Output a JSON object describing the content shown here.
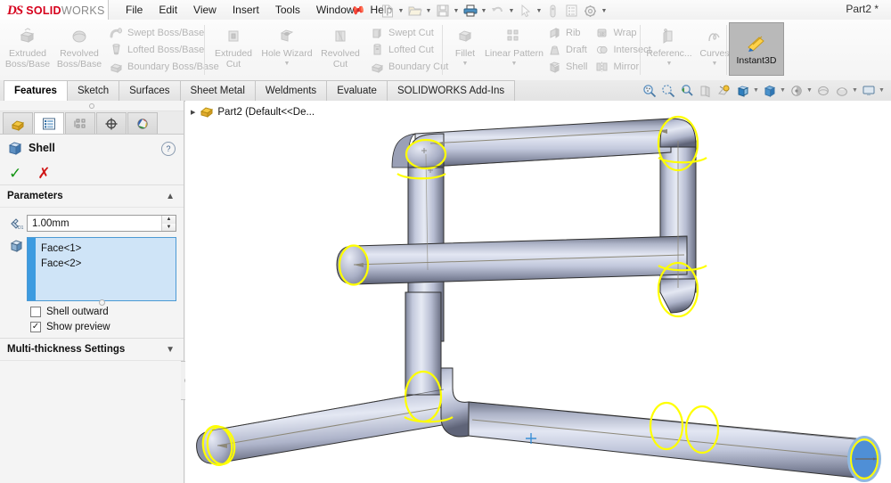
{
  "app": {
    "brand_ds": "DS",
    "brand_solid": "SOLID",
    "brand_works": "WORKS",
    "document_title": "Part2 *"
  },
  "menubar": {
    "items": [
      {
        "label": "File"
      },
      {
        "label": "Edit"
      },
      {
        "label": "View"
      },
      {
        "label": "Insert"
      },
      {
        "label": "Tools"
      },
      {
        "label": "Window"
      },
      {
        "label": "Help"
      }
    ],
    "pin_icon": "pushpin-icon"
  },
  "quick_access": {
    "buttons": [
      {
        "name": "new-document-icon",
        "has_dropdown": true
      },
      {
        "name": "open-document-icon",
        "has_dropdown": true
      },
      {
        "name": "save-icon",
        "has_dropdown": true
      },
      {
        "name": "print-icon",
        "has_dropdown": true,
        "active": true
      },
      {
        "name": "undo-icon",
        "has_dropdown": true
      },
      {
        "name": "select-cursor-icon",
        "has_dropdown": true
      },
      {
        "name": "rebuild-icon",
        "has_dropdown": false
      },
      {
        "name": "file-properties-icon",
        "has_dropdown": false
      },
      {
        "name": "options-gear-icon",
        "has_dropdown": true
      }
    ]
  },
  "ribbon": {
    "groups": [
      {
        "big": [
          {
            "label": "Extruded\nBoss/Base",
            "icon": "extruded-boss-icon",
            "enabled": false,
            "dropdown": false
          },
          {
            "label": "Revolved\nBoss/Base",
            "icon": "revolved-boss-icon",
            "enabled": false,
            "dropdown": false
          }
        ],
        "small": [
          {
            "label": "Swept Boss/Base",
            "icon": "swept-boss-icon"
          },
          {
            "label": "Lofted Boss/Base",
            "icon": "lofted-boss-icon"
          },
          {
            "label": "Boundary Boss/Base",
            "icon": "boundary-boss-icon"
          }
        ]
      },
      {
        "big": [
          {
            "label": "Extruded\nCut",
            "icon": "extruded-cut-icon",
            "enabled": false,
            "dropdown": false
          },
          {
            "label": "Hole Wizard",
            "icon": "hole-wizard-icon",
            "enabled": false,
            "dropdown": true
          },
          {
            "label": "Revolved\nCut",
            "icon": "revolved-cut-icon",
            "enabled": false,
            "dropdown": false
          }
        ],
        "small": [
          {
            "label": "Swept Cut",
            "icon": "swept-cut-icon"
          },
          {
            "label": "Lofted Cut",
            "icon": "lofted-cut-icon"
          },
          {
            "label": "Boundary Cut",
            "icon": "boundary-cut-icon"
          }
        ]
      },
      {
        "big": [
          {
            "label": "Fillet",
            "icon": "fillet-icon",
            "enabled": false,
            "dropdown": true
          },
          {
            "label": "Linear Pattern",
            "icon": "linear-pattern-icon",
            "enabled": false,
            "dropdown": true
          }
        ],
        "small": [
          {
            "label": "Rib",
            "icon": "rib-icon"
          },
          {
            "label": "Draft",
            "icon": "draft-icon"
          },
          {
            "label": "Shell",
            "icon": "shell-icon"
          }
        ],
        "small2": [
          {
            "label": "Wrap",
            "icon": "wrap-icon"
          },
          {
            "label": "Intersect",
            "icon": "intersect-icon"
          },
          {
            "label": "Mirror",
            "icon": "mirror-icon"
          }
        ]
      },
      {
        "big": [
          {
            "label": "Referenc...",
            "icon": "reference-geometry-icon",
            "enabled": false,
            "dropdown": true
          },
          {
            "label": "Curves",
            "icon": "curves-icon",
            "enabled": false,
            "dropdown": true
          }
        ]
      }
    ],
    "instant3d": {
      "label": "Instant3D",
      "icon": "instant3d-icon",
      "active": true
    }
  },
  "command_tabs": {
    "items": [
      {
        "label": "Features",
        "active": true
      },
      {
        "label": "Sketch",
        "active": false
      },
      {
        "label": "Surfaces",
        "active": false
      },
      {
        "label": "Sheet Metal",
        "active": false
      },
      {
        "label": "Weldments",
        "active": false
      },
      {
        "label": "Evaluate",
        "active": false
      },
      {
        "label": "SOLIDWORKS Add-Ins",
        "active": false
      }
    ]
  },
  "view_toolbar": {
    "buttons": [
      {
        "name": "zoom-to-fit-icon",
        "dropdown": false
      },
      {
        "name": "zoom-to-area-icon",
        "dropdown": false
      },
      {
        "name": "previous-view-icon",
        "dropdown": false
      },
      {
        "name": "section-view-icon",
        "dropdown": false
      },
      {
        "name": "view-orientation-icon",
        "dropdown": false
      },
      {
        "name": "display-style-icon",
        "dropdown": true
      },
      {
        "name": "hide-show-items-icon",
        "dropdown": true
      },
      {
        "name": "edit-appearance-icon",
        "dropdown": true
      },
      {
        "name": "apply-scene-icon",
        "dropdown": false
      },
      {
        "name": "view-settings-icon",
        "dropdown": true
      },
      {
        "name": "viewport-icon",
        "dropdown": true
      }
    ]
  },
  "property_manager": {
    "tabs": [
      {
        "name": "feature-manager-tab",
        "icon": "feature-tree-icon",
        "active": false
      },
      {
        "name": "property-manager-tab",
        "icon": "property-manager-icon",
        "active": true
      },
      {
        "name": "configuration-manager-tab",
        "icon": "configuration-icon",
        "active": false
      },
      {
        "name": "dimxpert-manager-tab",
        "icon": "dimxpert-icon",
        "active": false
      },
      {
        "name": "display-manager-tab",
        "icon": "display-manager-icon",
        "active": false
      }
    ],
    "title": "Shell",
    "title_icon": "shell-feature-icon",
    "help_icon": "help-question-icon",
    "accept_icon": "green-check-icon",
    "cancel_icon": "red-x-icon",
    "sections": [
      {
        "title": "Parameters",
        "thickness": {
          "icon": "thickness-icon",
          "value": "1.00mm"
        },
        "faces_to_remove": {
          "icon": "face-selection-icon",
          "items": [
            "Face<1>",
            "Face<2>"
          ]
        },
        "checkboxes": [
          {
            "label": "Shell outward",
            "checked": false
          },
          {
            "label": "Show preview",
            "checked": true
          }
        ]
      },
      {
        "title": "Multi-thickness Settings",
        "collapsed": true
      }
    ]
  },
  "feature_tree": {
    "root_label": "Part2  (Default<<De...",
    "root_icon": "part-document-icon",
    "expand_arrow": "▶"
  },
  "graphics": {
    "origin_marker": "origin-icon",
    "background": "#ffffff",
    "model_description": "Tubular weldment frame shown in isometric view with shell preview; two end faces highlighted",
    "colors": {
      "tube_light": "#d7dced",
      "tube_mid": "#a9b0c8",
      "tube_dark": "#5d6375",
      "edge": "#3a3a3a",
      "highlight_yellow": "#ffff00",
      "selection_blue": "#4f8fd6",
      "silhouette": "#8c8878"
    }
  }
}
